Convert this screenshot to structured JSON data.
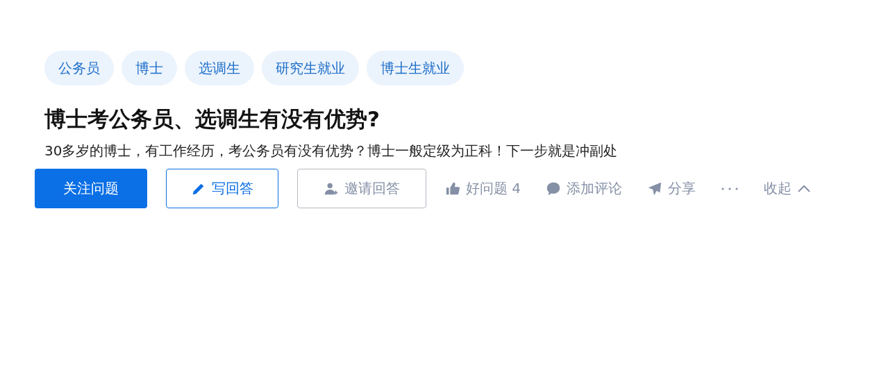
{
  "tags": [
    "公务员",
    "博士",
    "选调生",
    "研究生就业",
    "博士生就业"
  ],
  "title": "博士考公务员、选调生有没有优势?",
  "description": "30多岁的博士，有工作经历，考公务员有没有优势？博士一般定级为正科！下一步就是冲副处",
  "buttons": [
    {
      "kind": "primary",
      "label": "关注问题"
    },
    {
      "kind": "write",
      "label": "写回答"
    },
    {
      "kind": "invite",
      "label": "邀请回答"
    }
  ],
  "actions": [
    {
      "kind": "like",
      "label": "好问题 4"
    },
    {
      "kind": "comment",
      "label": "添加评论"
    },
    {
      "kind": "share",
      "label": "分享"
    },
    {
      "kind": "more"
    },
    {
      "kind": "collapse",
      "label": "收起"
    }
  ]
}
